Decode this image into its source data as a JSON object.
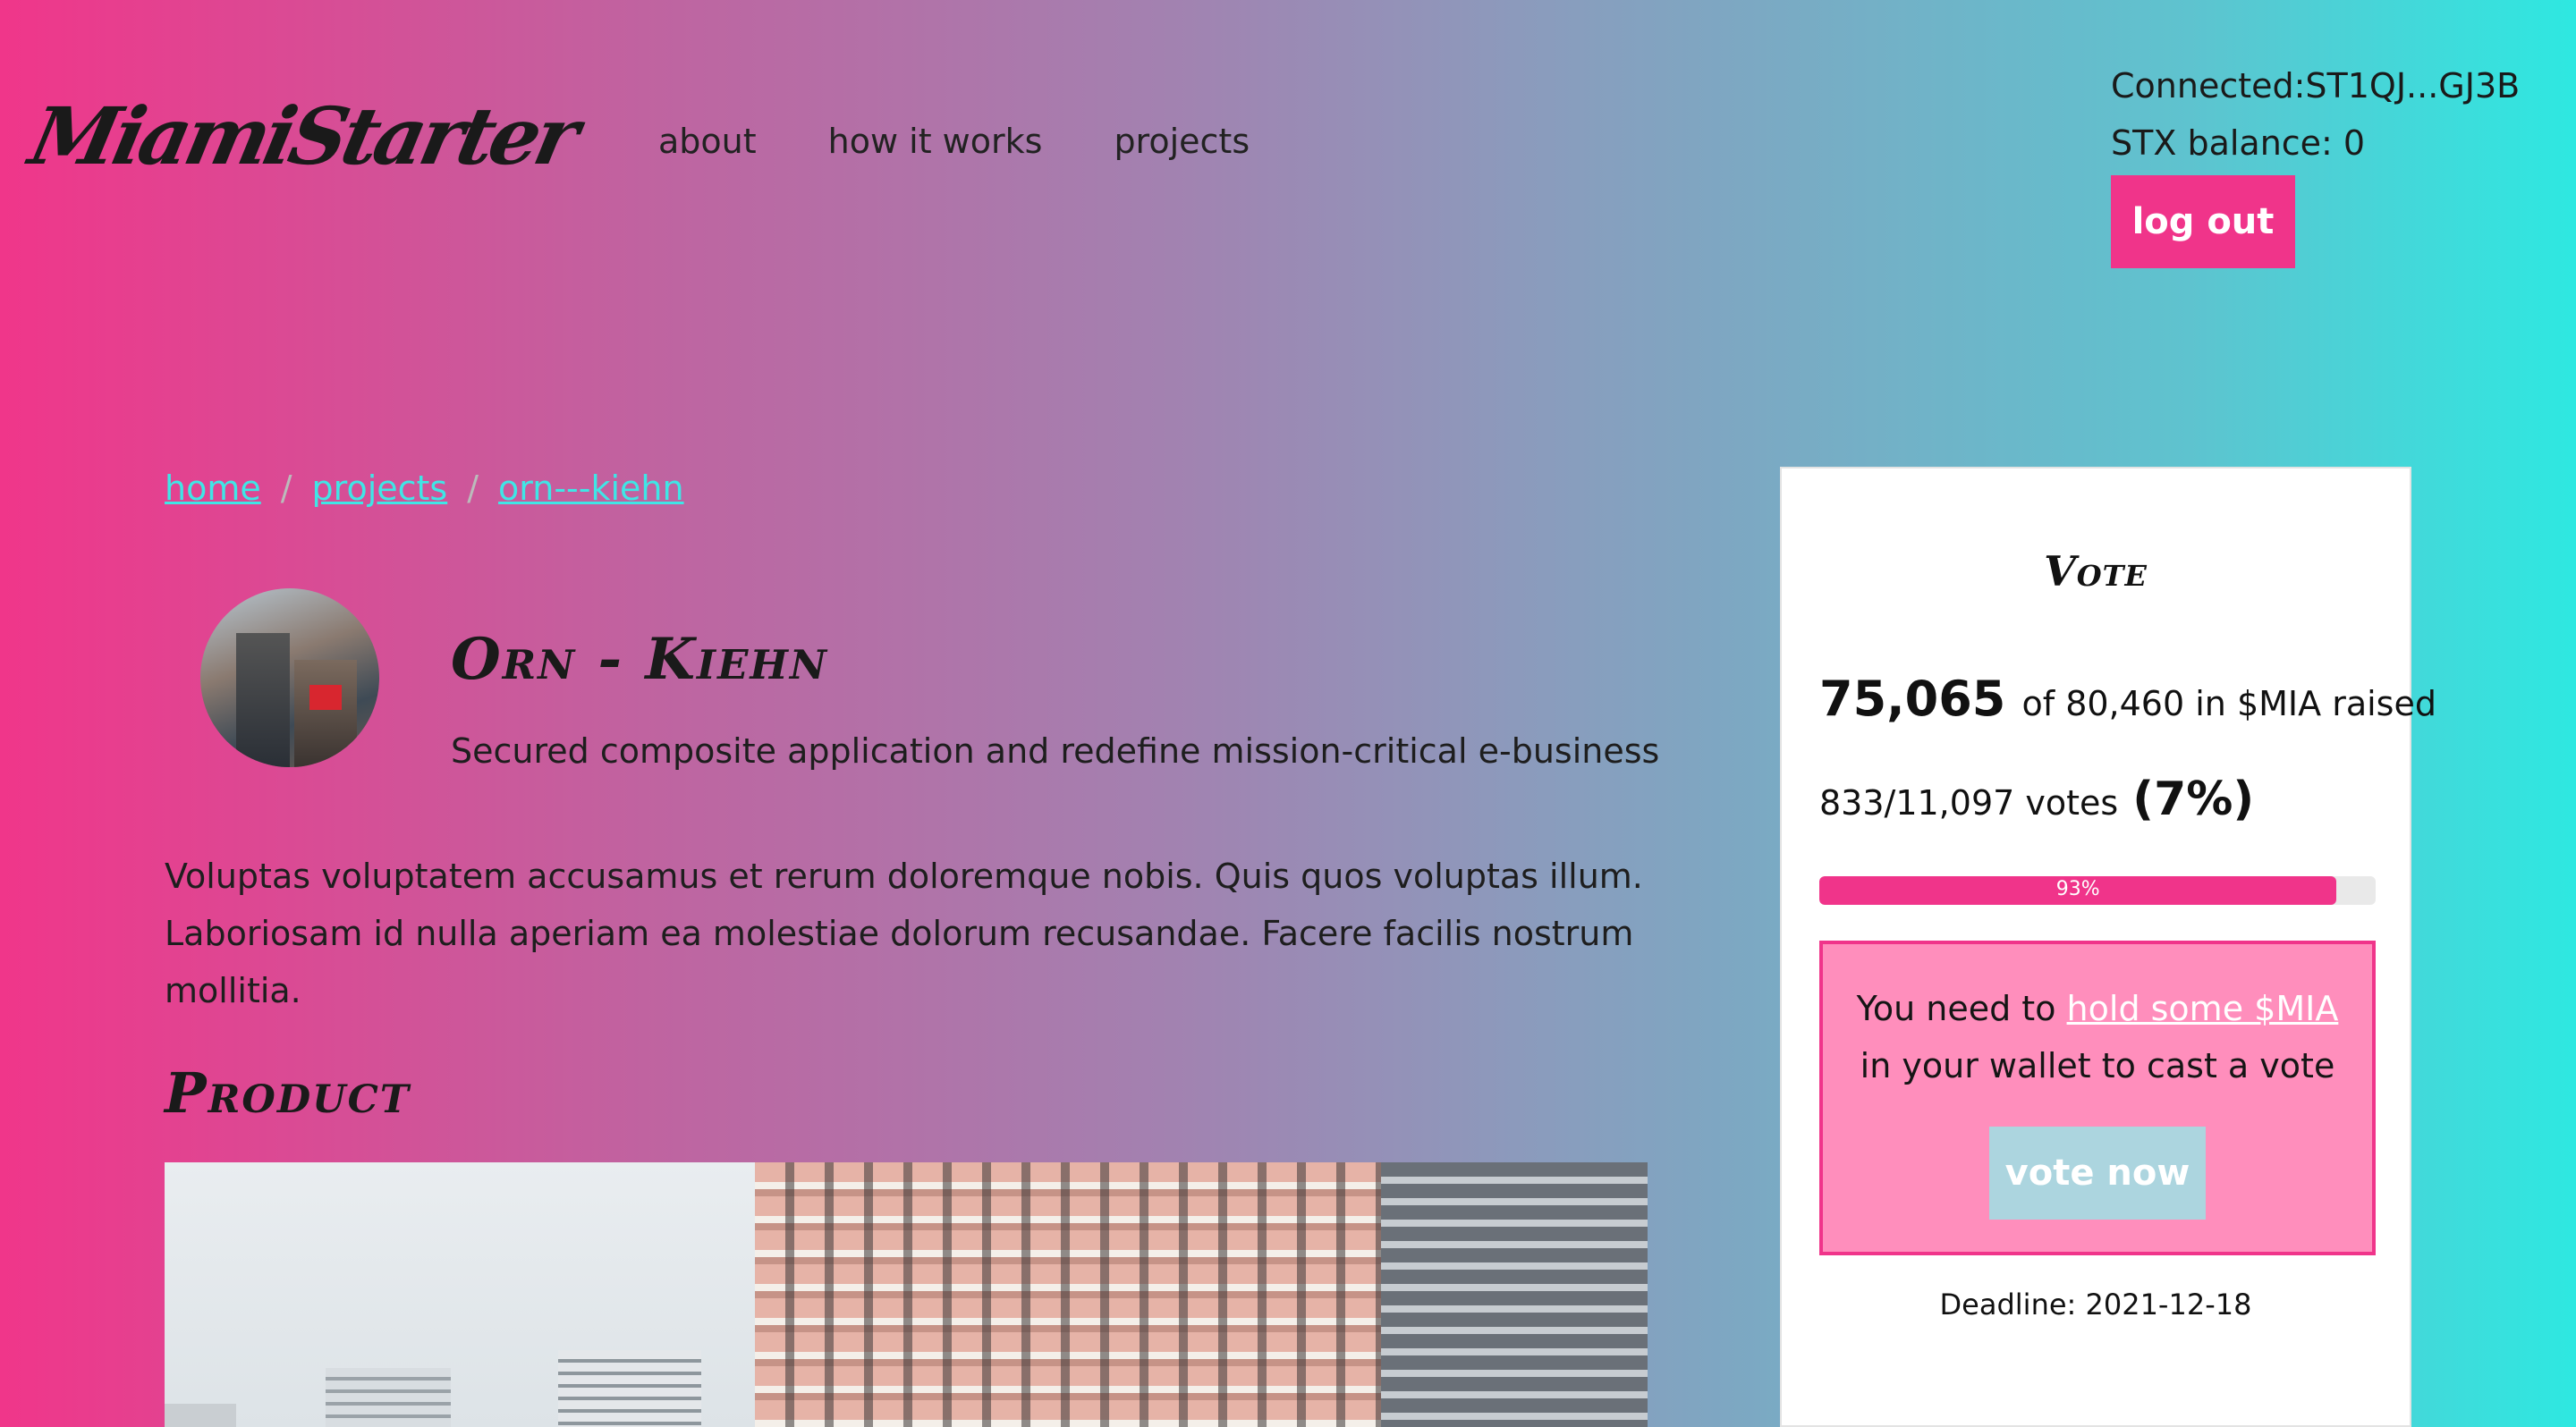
{
  "header": {
    "logo": "MiamiStarter",
    "nav": {
      "about": "about",
      "how_it_works": "how it works",
      "projects": "projects"
    },
    "account": {
      "connected": "Connected:ST1QJ...GJ3B",
      "balance": "STX balance: 0",
      "logout_label": "log out"
    }
  },
  "breadcrumb": {
    "home": "home",
    "projects": "projects",
    "current": "orn---kiehn",
    "separator": "/"
  },
  "project": {
    "title": "Orn - Kiehn",
    "tagline": "Secured composite application and redefine mission-critical e-business",
    "description": "Voluptas voluptatem accusamus et rerum doloremque nobis. Quis quos voluptas illum. Laboriosam id nulla aperiam ea molestiae dolorum recusandae. Facere facilis nostrum mollitia.",
    "product_heading": "Product"
  },
  "vote": {
    "title": "Vote",
    "raised_amount": "75,065",
    "raised_rest": "of 80,460 in $MIA raised",
    "votes_text": "833/11,097 votes",
    "votes_percent": "(7%)",
    "progress_label": "93%",
    "progress_value": 0.93,
    "notice_prefix": "You need to",
    "notice_link": "hold some $MIA",
    "notice_suffix": "in your wallet to cast a vote",
    "vote_button": "vote now",
    "deadline": "Deadline: 2021-12-18"
  },
  "colors": {
    "accent_pink": "#f0348a",
    "notice_pink": "#ff8ebc",
    "link_cyan": "#3fe6e6",
    "vote_button_disabled": "#acd5df"
  },
  "icons": []
}
